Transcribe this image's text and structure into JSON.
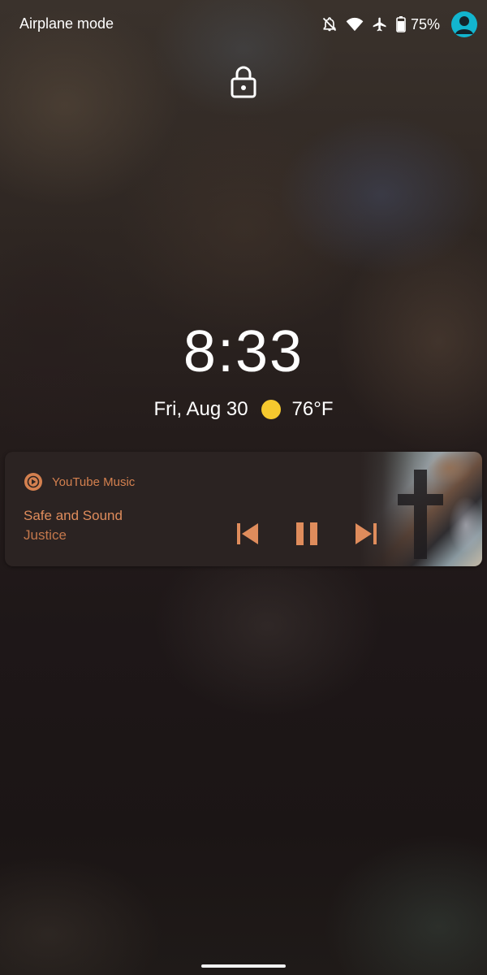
{
  "status_bar": {
    "mode_label": "Airplane mode",
    "battery_percent": "75%",
    "battery_level": 0.75,
    "icons": [
      "notifications-off-icon",
      "wifi-icon",
      "airplane-icon",
      "battery-icon",
      "account-avatar-icon"
    ]
  },
  "lockscreen": {
    "lock_icon": "lock-icon",
    "time": "8:33",
    "date": "Fri, Aug 30",
    "weather_icon": "sun-icon",
    "temperature": "76°F"
  },
  "media": {
    "app_name": "YouTube Music",
    "track_title": "Safe and Sound",
    "artist": "Justice",
    "controls": [
      "skip-previous-icon",
      "pause-icon",
      "skip-next-icon"
    ],
    "accent_color": "#d4804f"
  },
  "colors": {
    "avatar": "#12b5cf",
    "sun": "#f6c92e",
    "text": "#ffffff"
  }
}
